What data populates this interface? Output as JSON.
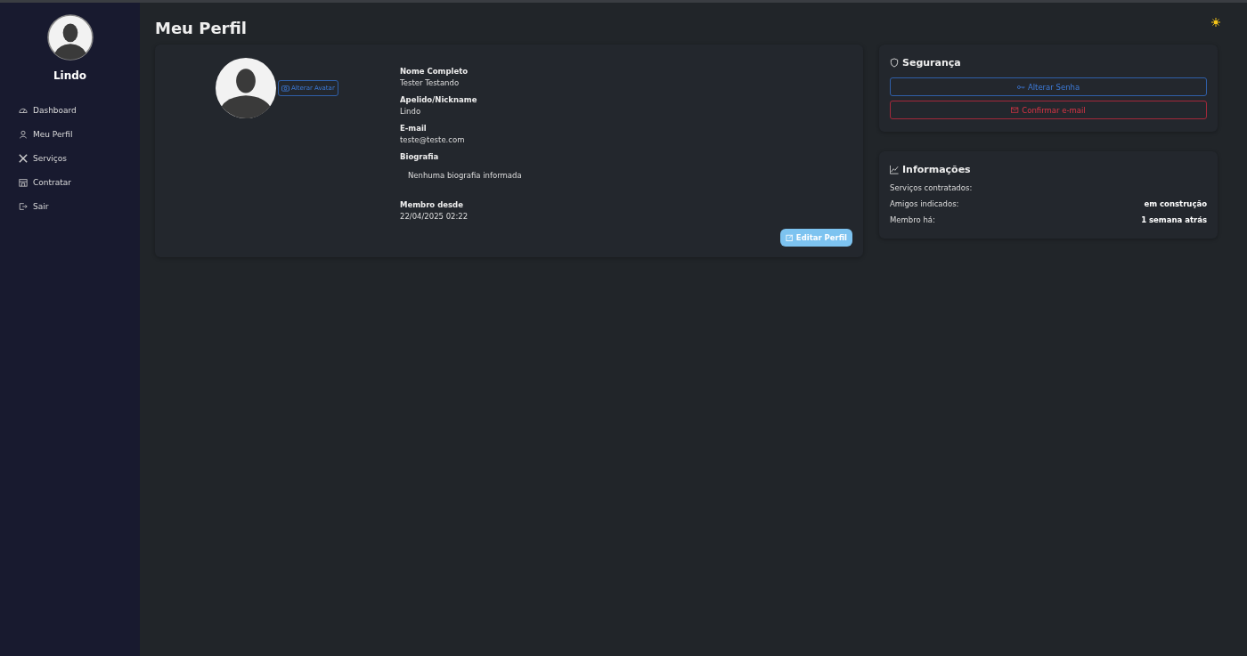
{
  "sidebar": {
    "username": "Lindo",
    "items": [
      {
        "label": "Dashboard",
        "selected": false
      },
      {
        "label": "Meu Perfil",
        "selected": false
      },
      {
        "label": "Serviços",
        "selected": false
      },
      {
        "label": "Contratar",
        "selected": false
      },
      {
        "label": "Sair",
        "selected": false
      }
    ]
  },
  "page_title": "Meu Perfil",
  "profile": {
    "change_avatar_button": "Alterar Avatar",
    "fields": [
      {
        "label": "Nome Completo",
        "value": "Tester Testando"
      },
      {
        "label": "Apelido/Nickname",
        "value": "Lindo"
      },
      {
        "label": "E-mail",
        "value": "teste@teste.com"
      },
      {
        "label": "Biografia",
        "value": "Nenhuma biografia informada",
        "kind": "bio"
      },
      {
        "label": "Membro desde",
        "value": "22/04/2025 02:22"
      }
    ],
    "edit_button": "Editar Perfil"
  },
  "security": {
    "title": "Segurança",
    "buttons": [
      {
        "label": "Alterar Senha",
        "kind": "primary"
      },
      {
        "label": "Confirmar e-mail",
        "kind": "danger"
      }
    ]
  },
  "info": {
    "title": "Informações",
    "rows": [
      {
        "label": "Serviços contratados:"
      },
      {
        "label": "Amigos indicados:",
        "value": "em construção"
      },
      {
        "label": "Membro há:",
        "value": "1 semana atrás"
      }
    ]
  }
}
